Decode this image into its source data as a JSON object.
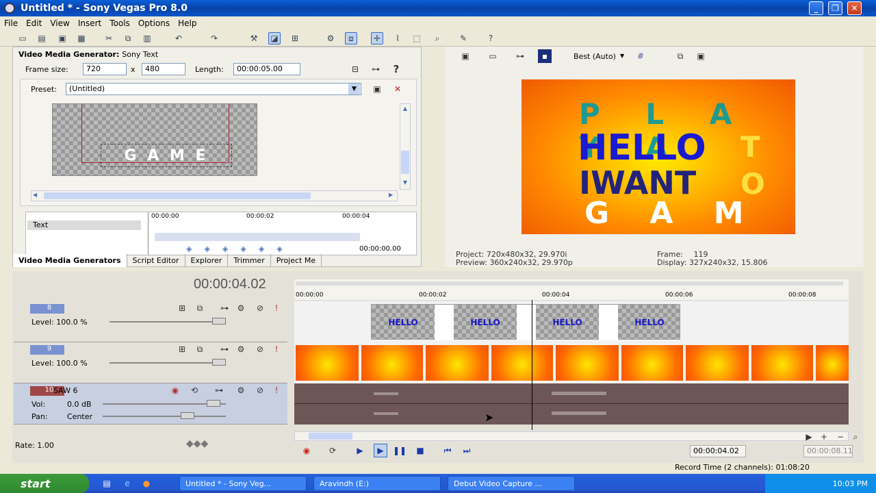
{
  "window": {
    "title": "Untitled * - Sony Vegas Pro 8.0"
  },
  "menu": [
    "File",
    "Edit",
    "View",
    "Insert",
    "Tools",
    "Options",
    "Help"
  ],
  "generator": {
    "header": "Video Media Generator:",
    "plugin": "Sony Text",
    "frame_size_label": "Frame size:",
    "width": "720",
    "x_sep": "x",
    "height": "480",
    "length_label": "Length:",
    "length": "00:00:05.00",
    "preset_label": "Preset:",
    "preset": "(Untitled)",
    "canvas_text": "G A M E",
    "track_label": "Text",
    "ruler": [
      "00:00:00",
      "00:00:02",
      "00:00:04"
    ],
    "timecode": "00:00:00.00"
  },
  "bottom_tabs": [
    "Video Media Generators",
    "Script Editor",
    "Explorer",
    "Trimmer",
    "Project Me"
  ],
  "preview": {
    "quality": "Best (Auto)",
    "lines": [
      {
        "text": "P L A Y A",
        "color": "#1e9a90"
      },
      {
        "text": "HELLO",
        "color": "#1a1ad0"
      },
      {
        "text": "T",
        "color": "#ffe040"
      },
      {
        "text": "IWANT",
        "color": "#23237a"
      },
      {
        "text": "O",
        "color": "#ffe040"
      },
      {
        "text": "G A M E",
        "color": "#ffffff"
      }
    ],
    "project_label": "Project:",
    "project": "720x480x32, 29.970i",
    "preview_label": "Preview:",
    "preview_val": "360x240x32, 29.970p",
    "frame_label": "Frame:",
    "frame": "119",
    "display_label": "Display:",
    "display": "327x240x32, 15.806"
  },
  "timeline": {
    "cursor_time": "00:00:04.02",
    "ruler": [
      "00:00:00",
      "00:00:02",
      "00:00:04",
      "00:00:06",
      "00:00:08"
    ],
    "tracks": [
      {
        "num": "8",
        "label": "Level: 100.0 %",
        "color": "#6f8fd6"
      },
      {
        "num": "9",
        "label": "Level: 100.0 %",
        "color": "#6f8fd6"
      },
      {
        "num": "10",
        "name": "SAW 6",
        "vol_label": "Vol:",
        "vol": "0.0 dB",
        "pan_label": "Pan:",
        "pan": "Center",
        "color": "#a04040"
      }
    ],
    "hello_clips": [
      "HELLO",
      "HELLO",
      "HELLO",
      "HELLO"
    ],
    "rate": "Rate: 1.00",
    "transport_time": "00:00:04.02",
    "end_time": "00:00:08.11"
  },
  "status": {
    "record": "Record Time (2 channels): 01:08:20"
  },
  "taskbar": {
    "start": "start",
    "tasks": [
      "Untitled * - Sony Veg...",
      "Aravindh (E:)",
      "Debut Video Capture ..."
    ],
    "clock": "10:03 PM"
  }
}
